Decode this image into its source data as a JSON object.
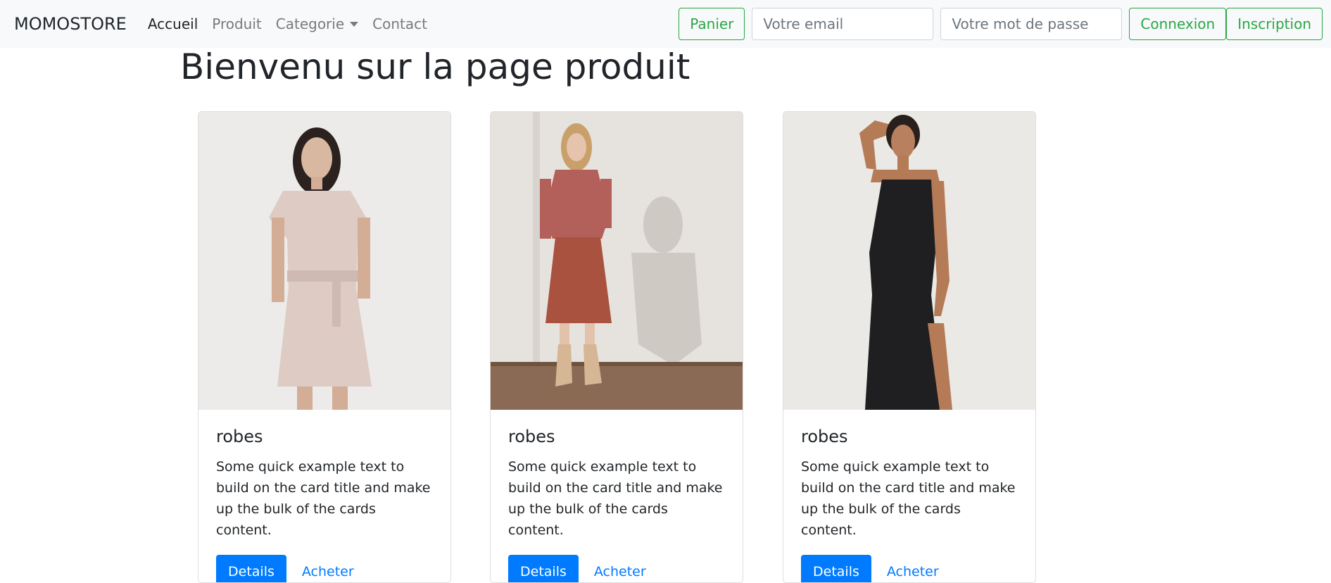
{
  "navbar": {
    "brand": "MOMOSTORE",
    "links": [
      {
        "label": "Accueil"
      },
      {
        "label": "Produit"
      },
      {
        "label": "Categorie"
      },
      {
        "label": "Contact"
      }
    ],
    "cart_label": "Panier",
    "email_placeholder": "Votre email",
    "password_placeholder": "Votre mot de passe",
    "login_label": "Connexion",
    "signup_label": "Inscription"
  },
  "main": {
    "title": "Bienvenu sur la page produit",
    "cards": [
      {
        "title": "robes",
        "text": "Some quick example text to build on the card title and make up the bulk of the cards content.",
        "details_label": "Details",
        "buy_label": "Acheter"
      },
      {
        "title": "robes",
        "text": "Some quick example text to build on the card title and make up the bulk of the cards content.",
        "details_label": "Details",
        "buy_label": "Acheter"
      },
      {
        "title": "robes",
        "text": "Some quick example text to build on the card title and make up the bulk of the cards content.",
        "details_label": "Details",
        "buy_label": "Acheter"
      }
    ]
  },
  "colors": {
    "navbar_bg": "#f8f9fa",
    "success": "#28a745",
    "primary": "#007bff"
  }
}
